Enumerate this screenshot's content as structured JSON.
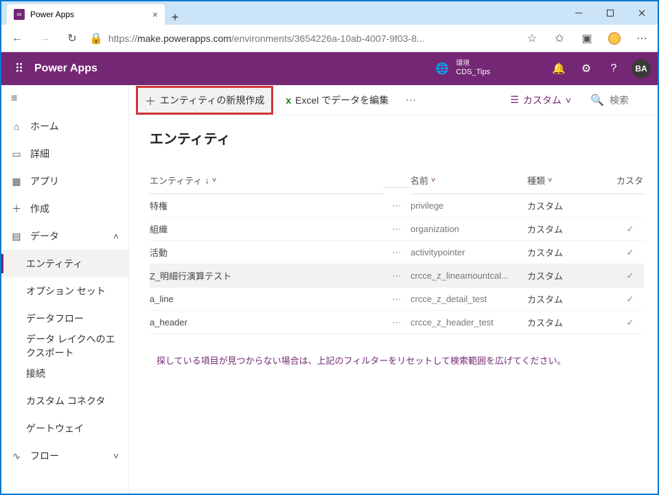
{
  "browser": {
    "tab_title": "Power Apps",
    "url_prefix": "https://",
    "url_host": "make.powerapps.com",
    "url_path": "/environments/3654226a-10ab-4007-9f03-8..."
  },
  "header": {
    "app_title": "Power Apps",
    "env_label": "環境",
    "env_name": "CDS_Tips",
    "avatar": "BA"
  },
  "sidebar": {
    "home": "ホーム",
    "detail": "詳細",
    "apps": "アプリ",
    "create": "作成",
    "data": "データ",
    "entity": "エンティティ",
    "optionsets": "オプション セット",
    "dataflow": "データフロー",
    "datalake": "データ レイクへのエクスポート",
    "conn": "接続",
    "custom": "カスタム コネクタ",
    "gateway": "ゲートウェイ",
    "flow": "フロー"
  },
  "cmd": {
    "new_entity": "エンティティの新規作成",
    "edit_excel": "Excel でデータを編集",
    "filter": "カスタム",
    "search_ph": "検索"
  },
  "page": {
    "title": "エンティティ",
    "cols": {
      "entity": "エンティティ",
      "name": "名前",
      "type": "種類",
      "cust": "カスタ"
    },
    "hint": "探している項目が見つからない場合は、上記のフィルターをリセットして検索範囲を広げてください。"
  },
  "rows": [
    {
      "entity": "特権",
      "name": "privilege",
      "type": "カスタム",
      "managed": false,
      "sel": false
    },
    {
      "entity": "組織",
      "name": "organization",
      "type": "カスタム",
      "managed": true,
      "sel": false
    },
    {
      "entity": "活動",
      "name": "activitypointer",
      "type": "カスタム",
      "managed": true,
      "sel": false
    },
    {
      "entity": "Z_明細行演算テスト",
      "name": "crcce_z_lineamountcal...",
      "type": "カスタム",
      "managed": true,
      "sel": true
    },
    {
      "entity": "a_line",
      "name": "crcce_z_detail_test",
      "type": "カスタム",
      "managed": true,
      "sel": false
    },
    {
      "entity": "a_header",
      "name": "crcce_z_header_test",
      "type": "カスタム",
      "managed": true,
      "sel": false
    }
  ]
}
